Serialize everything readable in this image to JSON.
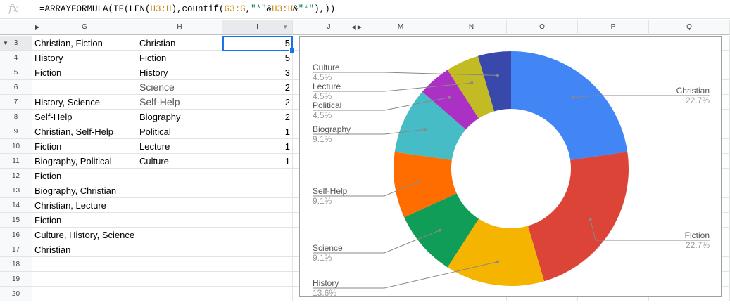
{
  "formula_bar": {
    "fx_label": "fx",
    "parts": [
      {
        "text": "=ARRAYFORMULA(IF(LEN(",
        "kind": "plain"
      },
      {
        "text": "H3:H",
        "kind": "ref"
      },
      {
        "text": "),countif(",
        "kind": "plain"
      },
      {
        "text": "G3:G",
        "kind": "ref"
      },
      {
        "text": ",",
        "kind": "plain"
      },
      {
        "text": "\"*\"",
        "kind": "str"
      },
      {
        "text": "&",
        "kind": "plain"
      },
      {
        "text": "H3:H",
        "kind": "ref"
      },
      {
        "text": "&",
        "kind": "plain"
      },
      {
        "text": "\"*\"",
        "kind": "str"
      },
      {
        "text": "),))",
        "kind": "plain"
      }
    ]
  },
  "columns": {
    "G": "G",
    "H": "H",
    "I": "I",
    "J": "J",
    "M": "M",
    "N": "N",
    "O": "O",
    "P": "P",
    "Q": "Q"
  },
  "rows": [
    "3",
    "4",
    "5",
    "6",
    "7",
    "8",
    "9",
    "10",
    "11",
    "12",
    "13",
    "14",
    "15",
    "16",
    "17",
    "18",
    "19",
    "20"
  ],
  "col_g": [
    "Christian, Fiction",
    "History",
    "Fiction",
    "",
    "History, Science",
    "Self-Help",
    "Christian, Self-Help",
    "Fiction",
    "Biography, Political",
    "Fiction",
    "Biography, Christian",
    "Christian, Lecture",
    "Fiction",
    "Culture, History, Science",
    "Christian",
    "",
    "",
    ""
  ],
  "col_h": [
    "Christian",
    "Fiction",
    "History",
    "Science",
    "Self-Help",
    "Biography",
    "Political",
    "Lecture",
    "Culture",
    "",
    "",
    "",
    "",
    "",
    "",
    "",
    "",
    ""
  ],
  "col_i": [
    "5",
    "5",
    "3",
    "2",
    "2",
    "2",
    "1",
    "1",
    "1",
    "",
    "",
    "",
    "",
    "",
    "",
    "",
    "",
    ""
  ],
  "chart_data": {
    "type": "pie",
    "donut": true,
    "slices": [
      {
        "label": "Christian",
        "value": 5,
        "percent": "22.7%",
        "color": "#4285f4"
      },
      {
        "label": "Fiction",
        "value": 5,
        "percent": "22.7%",
        "color": "#db4437"
      },
      {
        "label": "History",
        "value": 3,
        "percent": "13.6%",
        "color": "#f4b400"
      },
      {
        "label": "Science",
        "value": 2,
        "percent": "9.1%",
        "color": "#0f9d58"
      },
      {
        "label": "Self-Help",
        "value": 2,
        "percent": "9.1%",
        "color": "#ff6d00"
      },
      {
        "label": "Biography",
        "value": 2,
        "percent": "9.1%",
        "color": "#46bdc6"
      },
      {
        "label": "Political",
        "value": 1,
        "percent": "4.5%",
        "color": "#ab30c4"
      },
      {
        "label": "Lecture",
        "value": 1,
        "percent": "4.5%",
        "color": "#c2bb24"
      },
      {
        "label": "Culture",
        "value": 1,
        "percent": "4.5%",
        "color": "#3949ab"
      }
    ]
  }
}
